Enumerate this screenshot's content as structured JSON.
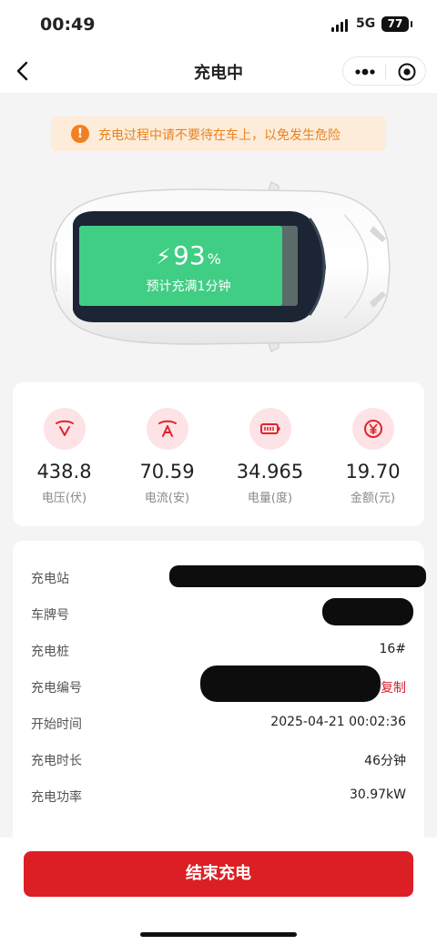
{
  "status_bar": {
    "time": "00:49",
    "network": "5G",
    "battery": "77"
  },
  "nav": {
    "title": "充电中",
    "more_icon": "more-dots-icon",
    "close_icon": "target-close-icon"
  },
  "warning": {
    "icon": "exclamation-icon",
    "text": "充电过程中请不要待在车上，以免发生危险"
  },
  "charging": {
    "percent": "93",
    "percent_sign": "%",
    "bolt": "⚡",
    "eta": "预计充满1分钟",
    "level": 0.93,
    "screen_color": "#3fce84"
  },
  "stats": [
    {
      "icon": "voltage-icon",
      "value": "438.8",
      "label": "电压(伏)"
    },
    {
      "icon": "current-icon",
      "value": "70.59",
      "label": "电流(安)"
    },
    {
      "icon": "battery-energy-icon",
      "value": "34.965",
      "label": "电量(度)"
    },
    {
      "icon": "yuan-amount-icon",
      "value": "19.70",
      "label": "金额(元)"
    }
  ],
  "info": {
    "station_label": "充电站",
    "plate_label": "车牌号",
    "pile_label": "充电桩",
    "pile_value": "16#",
    "order_label": "充电编号",
    "copy_label": "复制",
    "start_label": "开始时间",
    "start_value": "2025-04-21 00:02:36",
    "duration_label": "充电时长",
    "duration_value": "46分钟",
    "power_label": "充电功率",
    "power_value": "30.97kW"
  },
  "actions": {
    "end_label": "结束充电"
  },
  "colors": {
    "accent": "#dc1f24",
    "warning_text": "#e9831f",
    "warning_bg": "#fdecd9",
    "icon_bg": "#fde3e5",
    "charge_green": "#3fce84"
  }
}
